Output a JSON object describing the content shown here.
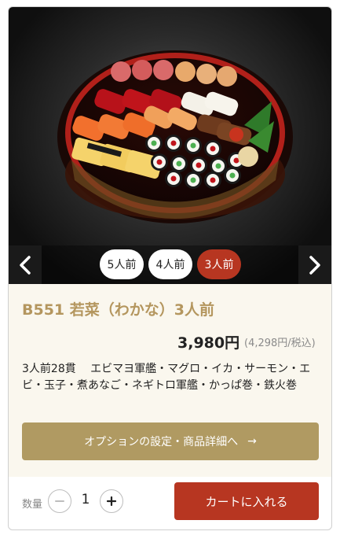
{
  "carousel": {
    "image_alt": "sushi-platter",
    "options": [
      {
        "label": "5人前",
        "active": false
      },
      {
        "label": "4人前",
        "active": false
      },
      {
        "label": "3人前",
        "active": true
      }
    ]
  },
  "product": {
    "title": "B551 若菜（わかな）3人前",
    "price": "3,980円",
    "tax_price": "(4,298円/税込)",
    "description": "3人前28貫　 エビマヨ軍艦・マグロ・イカ・サーモン・エビ・玉子・煮あなご・ネギトロ軍艦・かっぱ巻・鉄火巻"
  },
  "actions": {
    "option_button": "オプションの設定・商品詳細へ",
    "option_arrow": "→",
    "quantity_label": "数量",
    "quantity": "1",
    "cart_button": "カートに入れる"
  },
  "colors": {
    "accent_red": "#b73621",
    "accent_gold": "#b09a62",
    "title_gold": "#b4965e",
    "info_bg": "#faf7ee"
  }
}
